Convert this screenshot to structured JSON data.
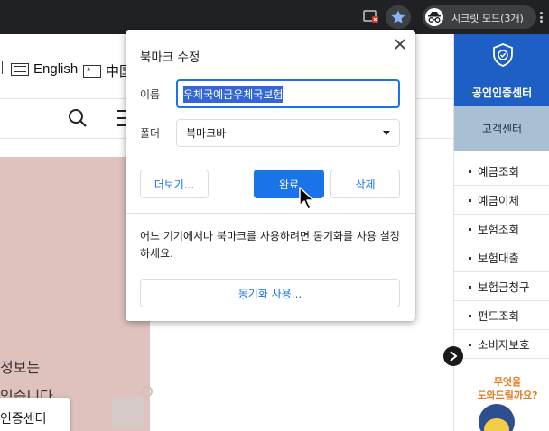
{
  "browser": {
    "incognito_label": "시크릿 모드(3개)",
    "colors": {
      "toolbar": "#202124",
      "chip": "#3c4043",
      "star": "#8ab4f8"
    }
  },
  "page": {
    "languages": [
      {
        "label": "English",
        "icon": "english-flag-icon"
      },
      {
        "label": "中国",
        "icon": "china-flag-icon"
      }
    ],
    "hero": {
      "line1": "정보는",
      "line2": "있습니다.",
      "card_label": "인증센터"
    },
    "side": {
      "cert_label": "공인인증센터",
      "cs_label": "고객센터",
      "menu": [
        "예금조회",
        "예금이체",
        "보험조회",
        "보험대출",
        "보험금청구",
        "펀드조회",
        "소비자보호"
      ],
      "mascot_line1": "무엇을",
      "mascot_line2": "도와드릴까요?",
      "colors": {
        "cert_bg": "#1d5fc4",
        "cs_bg": "#a9bfd3",
        "mascot_text": "#e07b1a"
      }
    }
  },
  "dialog": {
    "title": "북마크 수정",
    "name_label": "이름",
    "name_value": "우체국예금우체국보험",
    "folder_label": "폴더",
    "folder_value": "북마크바",
    "more_button": "더보기...",
    "done_button": "완료",
    "delete_button": "삭제",
    "sync_text": "어느 기기에서나 북마크를 사용하려면 동기화를 사용 설정하세요.",
    "sync_button": "동기화 사용...",
    "colors": {
      "primary": "#1a73e8",
      "selection": "#3367d6"
    }
  }
}
